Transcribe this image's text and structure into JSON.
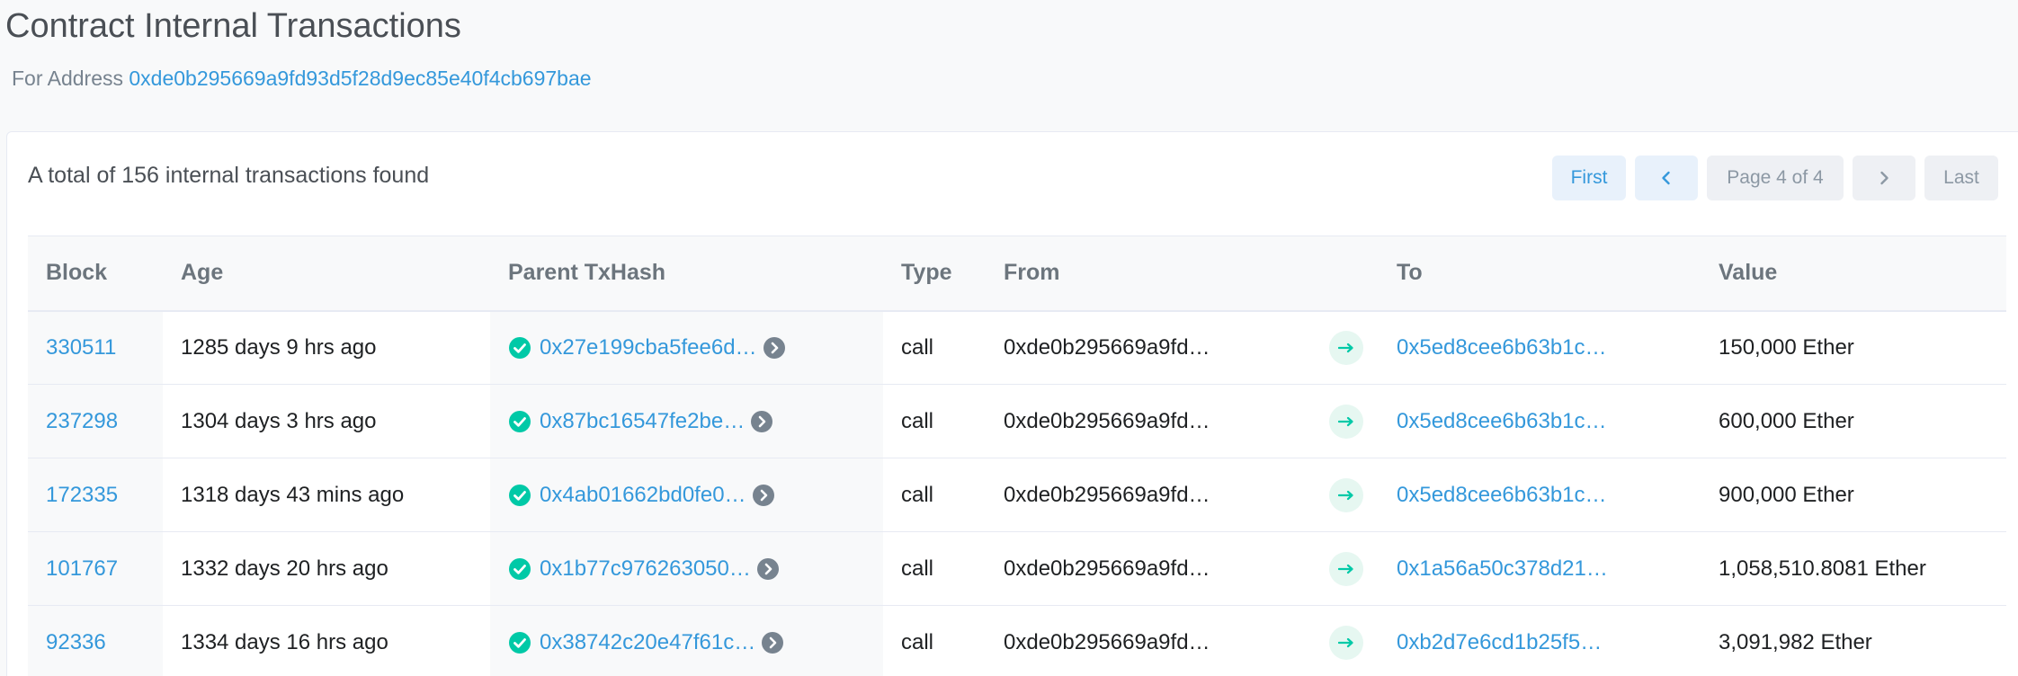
{
  "page": {
    "title": "Contract Internal Transactions",
    "address_prefix": "For Address",
    "address": "0xde0b295669a9fd93d5f28d9ec85e40f4cb697bae"
  },
  "summary": {
    "total_text": "A total of 156 internal transactions found"
  },
  "pagination": {
    "first": "First",
    "prev_icon": "chevron-left-icon",
    "page_text": "Page 4 of 4",
    "next_icon": "chevron-right-icon",
    "last": "Last"
  },
  "table": {
    "headers": {
      "block": "Block",
      "age": "Age",
      "parent_txhash": "Parent TxHash",
      "type": "Type",
      "from": "From",
      "to": "To",
      "value": "Value"
    },
    "rows": [
      {
        "block": "330511",
        "age": "1285 days 9 hrs ago",
        "parent_txhash": "0x27e199cba5fee6d…",
        "type": "call",
        "from": "0xde0b295669a9fd…",
        "to": "0x5ed8cee6b63b1c…",
        "value": "150,000 Ether"
      },
      {
        "block": "237298",
        "age": "1304 days 3 hrs ago",
        "parent_txhash": "0x87bc16547fe2be…",
        "type": "call",
        "from": "0xde0b295669a9fd…",
        "to": "0x5ed8cee6b63b1c…",
        "value": "600,000 Ether"
      },
      {
        "block": "172335",
        "age": "1318 days 43 mins ago",
        "parent_txhash": "0x4ab01662bd0fe0…",
        "type": "call",
        "from": "0xde0b295669a9fd…",
        "to": "0x5ed8cee6b63b1c…",
        "value": "900,000 Ether"
      },
      {
        "block": "101767",
        "age": "1332 days 20 hrs ago",
        "parent_txhash": "0x1b77c976263050…",
        "type": "call",
        "from": "0xde0b295669a9fd…",
        "to": "0x1a56a50c378d21…",
        "value": "1,058,510.8081 Ether"
      },
      {
        "block": "92336",
        "age": "1334 days 16 hrs ago",
        "parent_txhash": "0x38742c20e47f61c…",
        "type": "call",
        "from": "0xde0b295669a9fd…",
        "to": "0xb2d7e6cd1b25f5…",
        "value": "3,091,982 Ether"
      }
    ]
  },
  "colors": {
    "link": "#3498db",
    "success": "#00c9a7",
    "arrow_bg": "#e6f7f1"
  }
}
